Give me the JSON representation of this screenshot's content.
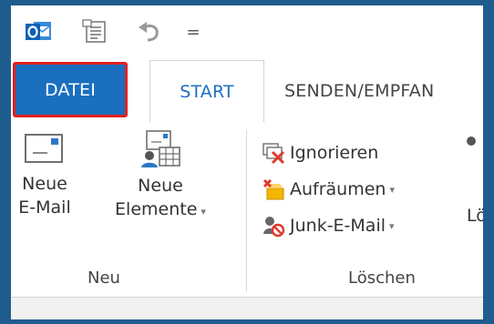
{
  "colors": {
    "file_tab_bg": "#1a6fbf",
    "file_tab_highlight": "#e02020",
    "active_tab_text": "#1e6fc0",
    "frame_border": "#1f5d8e"
  },
  "qat": {
    "icons": [
      "outlook-app-icon",
      "sync-folder-icon",
      "undo-icon",
      "customize-qat-icon"
    ],
    "customize_glyph": "="
  },
  "tabs": [
    {
      "label": "DATEI"
    },
    {
      "label": "START"
    },
    {
      "label": "SENDEN/EMPFAN"
    }
  ],
  "ribbon": {
    "neu_group": {
      "new_email": {
        "line1": "Neue",
        "line2": "E-Mail"
      },
      "new_items": {
        "line1": "Neue",
        "line2": "Elemente",
        "caret": "▾"
      },
      "label": "Neu"
    },
    "loeschen_group": {
      "ignore": "Ignorieren",
      "cleanup": "Aufräumen",
      "junk": "Junk-E-Mail",
      "caret": "▾",
      "delete_partial": "Lö",
      "label": "Löschen"
    }
  }
}
